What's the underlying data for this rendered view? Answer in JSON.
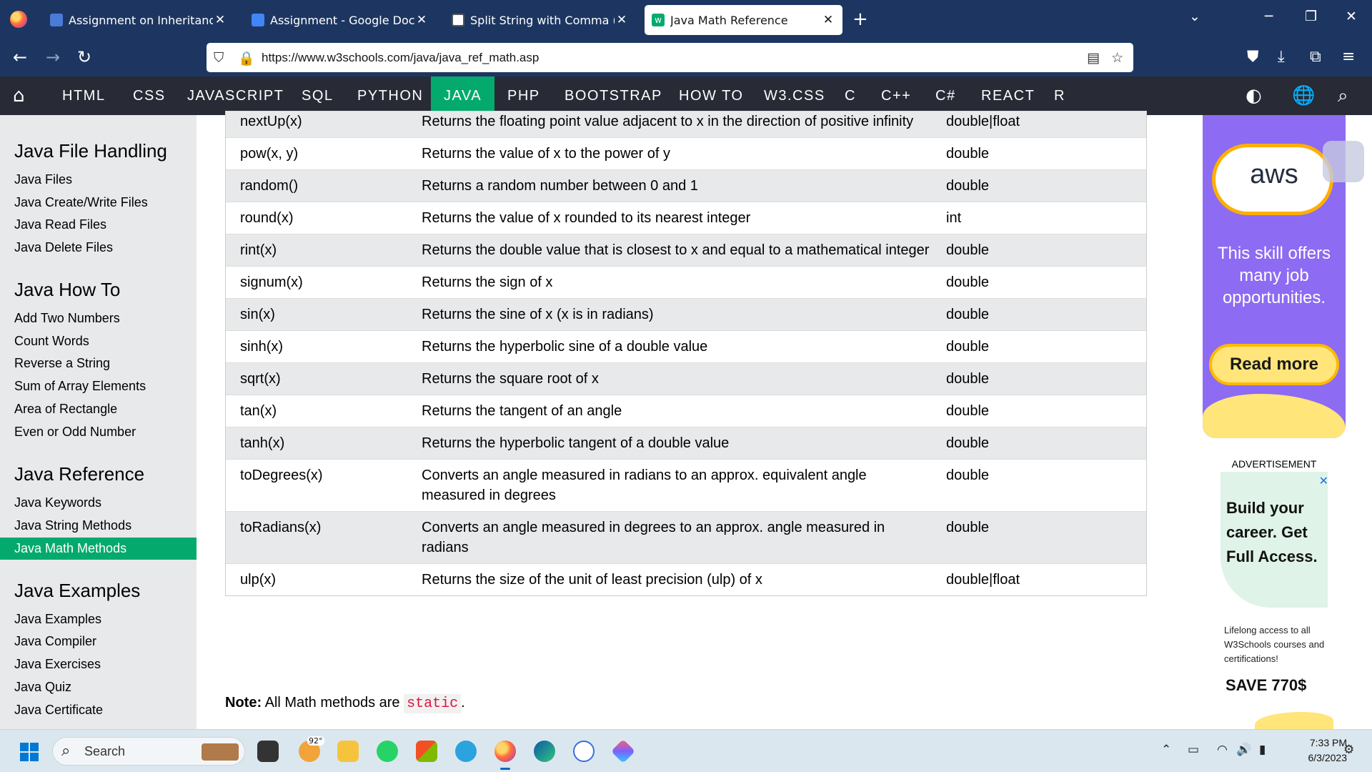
{
  "browser": {
    "tabs": [
      {
        "title": "Assignment on Inheritance, Strin",
        "active": false
      },
      {
        "title": "Assignment - Google Docs",
        "active": false
      },
      {
        "title": "Split String with Comma ( ) in Ja",
        "active": false
      },
      {
        "title": "Java Math Reference",
        "active": true
      }
    ],
    "url": "https://www.w3schools.com/java/java_ref_math.asp"
  },
  "w3nav": {
    "items": [
      "HTML",
      "CSS",
      "JAVASCRIPT",
      "SQL",
      "PYTHON",
      "JAVA",
      "PHP",
      "BOOTSTRAP",
      "HOW TO",
      "W3.CSS",
      "C",
      "C++",
      "C#",
      "REACT",
      "R"
    ],
    "active": "JAVA"
  },
  "sidebar": {
    "sections": [
      {
        "heading": "Java File Handling",
        "items": [
          "Java Files",
          "Java Create/Write Files",
          "Java Read Files",
          "Java Delete Files"
        ]
      },
      {
        "heading": "Java How To",
        "items": [
          "Add Two Numbers",
          "Count Words",
          "Reverse a String",
          "Sum of Array Elements",
          "Area of Rectangle",
          "Even or Odd Number"
        ]
      },
      {
        "heading": "Java Reference",
        "items": [
          "Java Keywords",
          "Java String Methods",
          "Java Math Methods"
        ]
      },
      {
        "heading": "Java Examples",
        "items": [
          "Java Examples",
          "Java Compiler",
          "Java Exercises",
          "Java Quiz",
          "Java Certificate"
        ]
      }
    ],
    "active_item": "Java Math Methods"
  },
  "table": {
    "rows": [
      {
        "method": "nextUp(x)",
        "description": "Returns the floating point value adjacent to x in the direction of positive infinity",
        "return_type": "double|float"
      },
      {
        "method": "pow(x, y)",
        "description": "Returns the value of x to the power of y",
        "return_type": "double"
      },
      {
        "method": "random()",
        "description": "Returns a random number between 0 and 1",
        "return_type": "double"
      },
      {
        "method": "round(x)",
        "description": "Returns the value of x rounded to its nearest integer",
        "return_type": "int"
      },
      {
        "method": "rint(x)",
        "description": "Returns the double value that is closest to x and equal to a mathematical integer",
        "return_type": "double"
      },
      {
        "method": "signum(x)",
        "description": "Returns the sign of x",
        "return_type": "double"
      },
      {
        "method": "sin(x)",
        "description": "Returns the sine of x (x is in radians)",
        "return_type": "double"
      },
      {
        "method": "sinh(x)",
        "description": "Returns the hyperbolic sine of a double value",
        "return_type": "double"
      },
      {
        "method": "sqrt(x)",
        "description": "Returns the square root of x",
        "return_type": "double"
      },
      {
        "method": "tan(x)",
        "description": "Returns the tangent of an angle",
        "return_type": "double"
      },
      {
        "method": "tanh(x)",
        "description": "Returns the hyperbolic tangent of a double value",
        "return_type": "double"
      },
      {
        "method": "toDegrees(x)",
        "description": "Converts an angle measured in radians to an approx. equivalent angle measured in degrees",
        "return_type": "double"
      },
      {
        "method": "toRadians(x)",
        "description": "Converts an angle measured in degrees to an approx. angle measured in radians",
        "return_type": "double"
      },
      {
        "method": "ulp(x)",
        "description": "Returns the size of the unit of least precision (ulp) of x",
        "return_type": "double|float"
      }
    ]
  },
  "note": {
    "label": "Note:",
    "text": "All Math methods are",
    "code": "static",
    "end": "."
  },
  "ads": {
    "aws": {
      "logo": "aws",
      "copy": "This skill offers many job opportunities.",
      "button": "Read more"
    },
    "label": "ADVERTISEMENT",
    "w3": {
      "headline": "Build your career. Get Full Access.",
      "sub": "Lifelong access to all W3Schools courses and certifications!",
      "save": "SAVE 770$"
    }
  },
  "taskbar": {
    "search_label": "Search",
    "weather": "92°",
    "time": "7:33 PM",
    "date": "6/3/2023"
  },
  "colors": {
    "chrome": "#1d3661",
    "w3nav": "#282a35",
    "accent": "#04aa6d",
    "sidebar": "#e7e9eb"
  }
}
